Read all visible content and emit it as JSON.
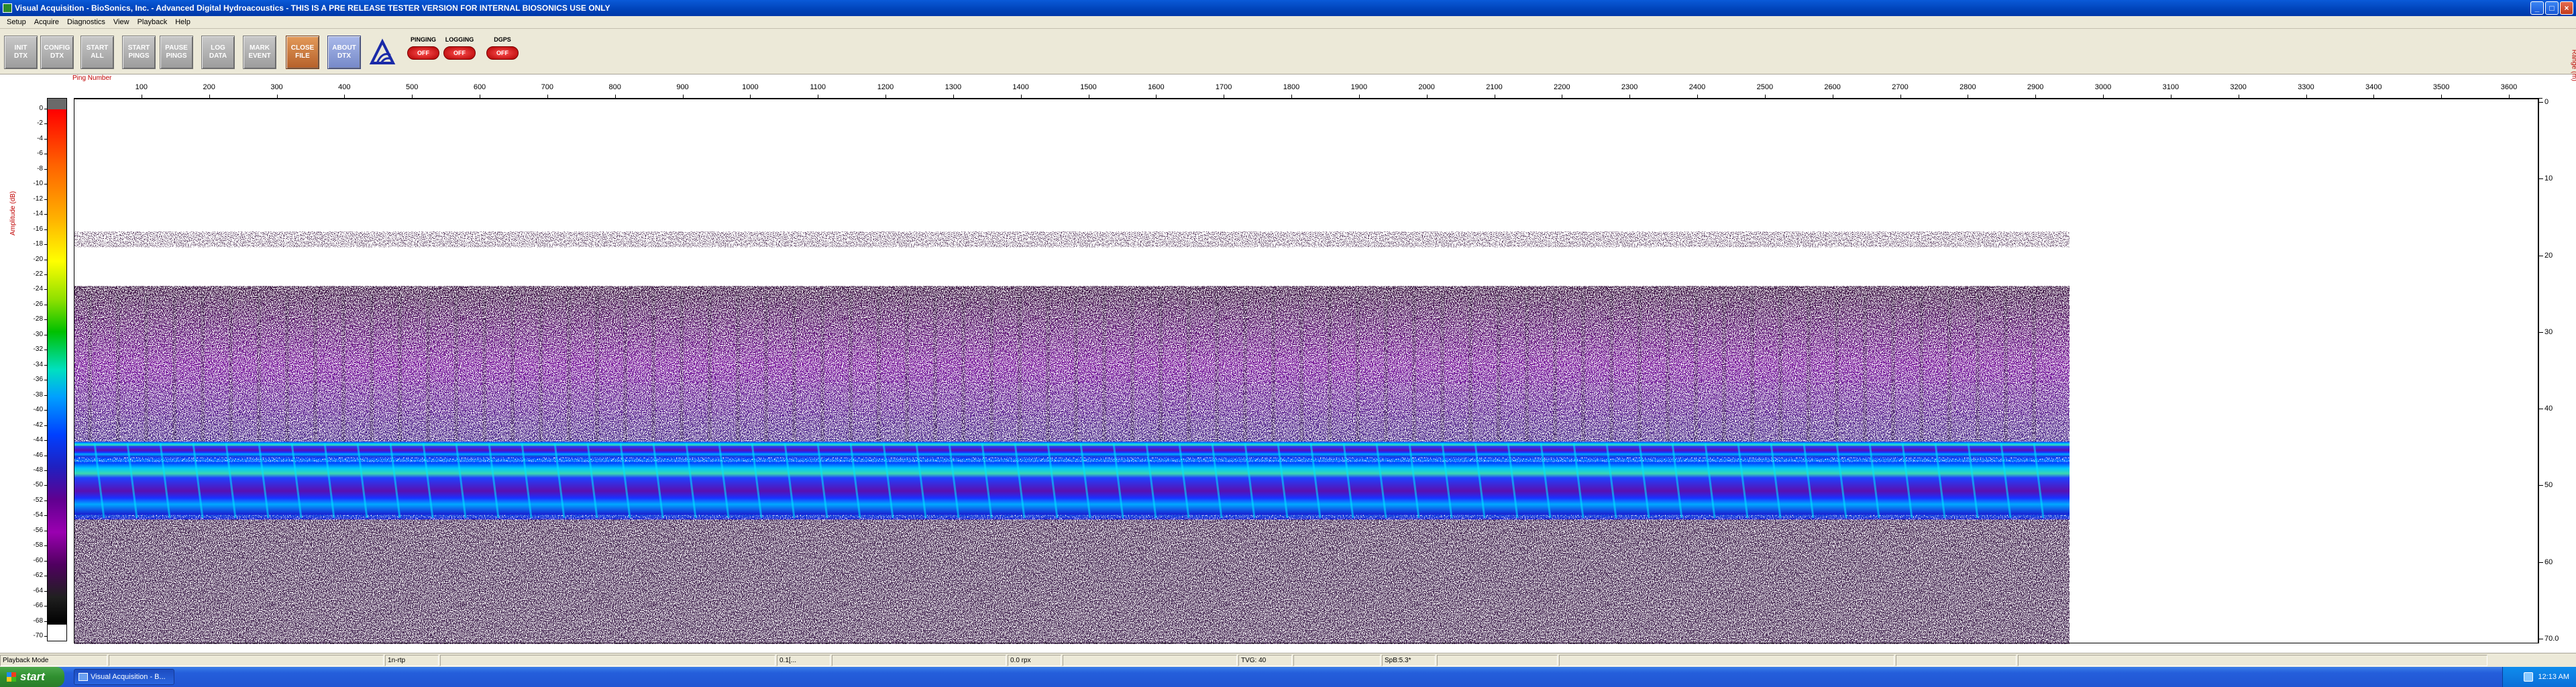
{
  "window": {
    "title": "Visual Acquisition  -  BioSonics, Inc.  -  Advanced Digital Hydroacoustics  -  THIS IS A PRE RELEASE TESTER VERSION FOR INTERNAL BIOSONICS USE ONLY",
    "buttons": {
      "minimize": "_",
      "maximize": "□",
      "close": "×"
    }
  },
  "menu": [
    "Setup",
    "Acquire",
    "Diagnostics",
    "View",
    "Playback",
    "Help"
  ],
  "toolbar": {
    "buttons": [
      {
        "line1": "INIT",
        "line2": "DTX",
        "style": "gray"
      },
      {
        "line1": "CONFIG",
        "line2": "DTX",
        "style": "gray"
      },
      {
        "line1": "START",
        "line2": "ALL",
        "style": "gray"
      },
      {
        "line1": "START",
        "line2": "PINGS",
        "style": "gray"
      },
      {
        "line1": "PAUSE",
        "line2": "PINGS",
        "style": "gray"
      },
      {
        "line1": "LOG",
        "line2": "DATA",
        "style": "gray"
      },
      {
        "line1": "MARK",
        "line2": "EVENT",
        "style": "gray"
      },
      {
        "line1": "CLOSE",
        "line2": "FILE",
        "style": "orange"
      },
      {
        "line1": "ABOUT",
        "line2": "DTX",
        "style": "blue"
      }
    ],
    "status": [
      {
        "label": "PINGING",
        "value": "OFF"
      },
      {
        "label": "LOGGING",
        "value": "OFF"
      },
      {
        "label": "DGPS",
        "value": "OFF"
      }
    ]
  },
  "plot": {
    "ping_axis_title": "Ping Number",
    "amplitude_title": "Amplitude (dB)",
    "range_title": "Range (m)",
    "ping_ticks": [
      "100",
      "200",
      "300",
      "400",
      "500",
      "600",
      "700",
      "800",
      "900",
      "1000",
      "1100",
      "1200",
      "1300",
      "1400",
      "1500",
      "1600",
      "1700",
      "1800",
      "1900",
      "2000",
      "2100",
      "2200",
      "2300",
      "2400",
      "2500",
      "2600",
      "2700",
      "2800",
      "2900",
      "3000",
      "3100",
      "3200",
      "3300",
      "3400",
      "3500",
      "3600"
    ],
    "amplitude_ticks": [
      "0",
      "-2",
      "-4",
      "-6",
      "-8",
      "-10",
      "-12",
      "-14",
      "-16",
      "-18",
      "-20",
      "-22",
      "-24",
      "-26",
      "-28",
      "-30",
      "-32",
      "-34",
      "-36",
      "-38",
      "-40",
      "-42",
      "-44",
      "-46",
      "-48",
      "-50",
      "-52",
      "-54",
      "-56",
      "-58",
      "-60",
      "-62",
      "-64",
      "-66",
      "-68",
      "-70"
    ],
    "range_ticks": [
      "0",
      "10",
      "20",
      "30",
      "40",
      "50",
      "60",
      "70.0"
    ]
  },
  "chart_data": {
    "type": "heatmap",
    "xlabel": "Ping Number",
    "ylabel": "Range (m)",
    "colorbar_label": "Amplitude (dB)",
    "xlim": [
      0,
      3600
    ],
    "ylim": [
      0,
      70
    ],
    "colorbar_range": [
      -70,
      0
    ],
    "data_extent_pings": [
      0,
      2970
    ],
    "features": [
      {
        "name": "scatter layer",
        "range_m": [
          17,
          19
        ]
      },
      {
        "name": "water column noise",
        "range_m": [
          24,
          44
        ]
      },
      {
        "name": "strong band",
        "range_m": [
          44,
          46
        ]
      },
      {
        "name": "dense band",
        "range_m": [
          46,
          54
        ]
      },
      {
        "name": "bottom noise",
        "range_m": [
          54,
          70
        ]
      }
    ]
  },
  "statusbar": [
    "Playback Mode",
    "",
    "1n-rtp",
    "",
    "0.1[...",
    "",
    "0.0 rpx",
    "",
    "TVG: 40",
    "",
    "SpB:5.3*",
    "",
    "",
    "",
    ""
  ],
  "taskbar": {
    "start_label": "start",
    "task_label": "Visual Acquisition  -  B...",
    "clock": "12:13 AM"
  },
  "colors": {
    "title_bar": "#0042b8",
    "axis_titles": "#c00000",
    "echo_band": "#0040ff",
    "noise": "#6a008f"
  }
}
